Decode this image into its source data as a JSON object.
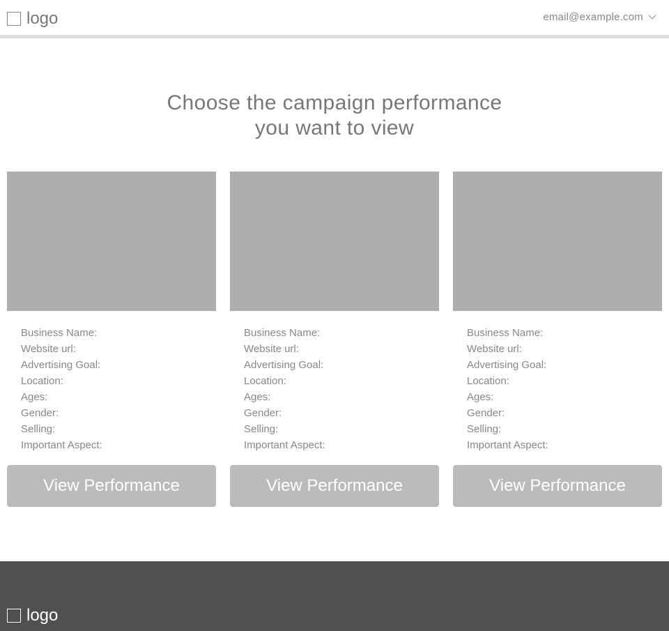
{
  "header": {
    "logo_label": "logo",
    "account_email": "email@example.com",
    "account_icon": "chevron-down-icon"
  },
  "main": {
    "headline_line1": "Choose the campaign performance",
    "headline_line2": "you want to view",
    "cards": [
      {
        "fields": [
          "Business Name:",
          "Website url:",
          "Advertising Goal:",
          "Location:",
          "Ages:",
          "Gender:",
          "Selling:",
          "Important Aspect:"
        ],
        "button_label": "View Performance"
      },
      {
        "fields": [
          "Business Name:",
          "Website url:",
          "Advertising Goal:",
          "Location:",
          "Ages:",
          "Gender:",
          "Selling:",
          "Important Aspect:"
        ],
        "button_label": "View Performance"
      },
      {
        "fields": [
          "Business Name:",
          "Website url:",
          "Advertising Goal:",
          "Location:",
          "Ages:",
          "Gender:",
          "Selling:",
          "Important Aspect:"
        ],
        "button_label": "View Performance"
      }
    ]
  },
  "footer": {
    "logo_label": "logo"
  },
  "colors": {
    "placeholder_image": "#aeaeae",
    "button_bg": "#bbbbbb",
    "footer_bg": "#505050"
  }
}
